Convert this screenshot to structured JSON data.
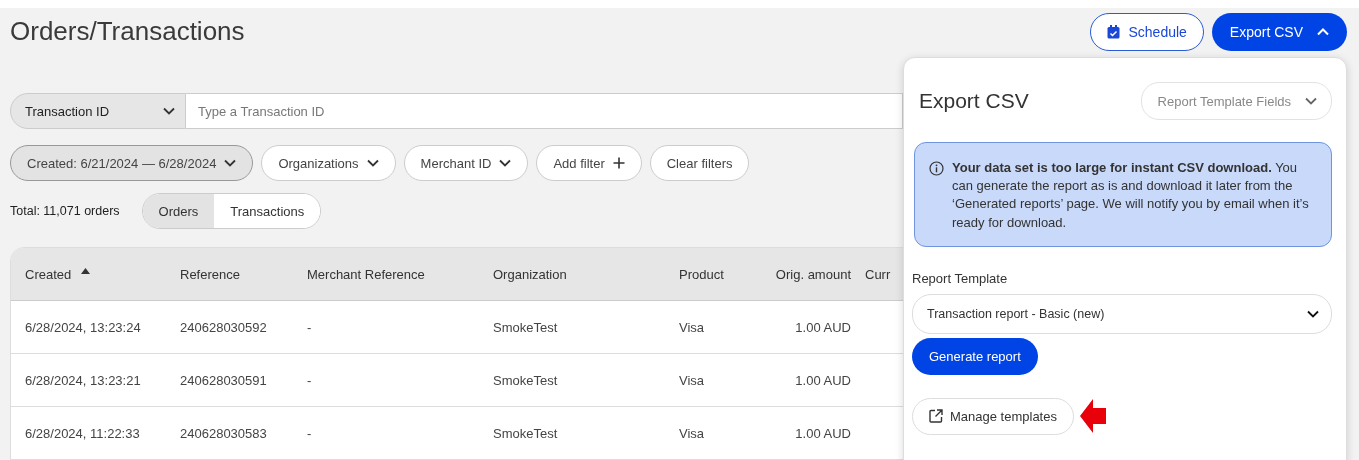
{
  "page": {
    "title": "Orders/Transactions"
  },
  "header_buttons": [
    {
      "kind": "schedule",
      "label": "Schedule"
    },
    {
      "kind": "export",
      "label": "Export CSV",
      "expanded": true
    }
  ],
  "search": {
    "type_select": "Transaction ID",
    "placeholder": "Type a Transaction ID"
  },
  "filters": [
    {
      "kind": "date",
      "label": "Created: 6/21/2024 — 6/28/2024",
      "active": true
    },
    {
      "kind": "dropdown",
      "label": "Organizations",
      "active": false
    },
    {
      "kind": "dropdown",
      "label": "Merchant ID",
      "active": false
    },
    {
      "kind": "add",
      "label": "Add filter",
      "active": false
    },
    {
      "kind": "clear",
      "label": "Clear filters",
      "active": false
    }
  ],
  "total": "Total: 11,071 orders",
  "view_tabs": [
    {
      "label": "Orders",
      "selected": true
    },
    {
      "label": "Transactions",
      "selected": false
    }
  ],
  "table": {
    "columns": [
      {
        "label": "Created",
        "sorted": true
      },
      {
        "label": "Reference",
        "sorted": false
      },
      {
        "label": "Merchant Reference",
        "sorted": false
      },
      {
        "label": "Organization",
        "sorted": false
      },
      {
        "label": "Product",
        "sorted": false
      },
      {
        "label": "Orig. amount",
        "sorted": false
      },
      {
        "label": "Curr",
        "sorted": false
      }
    ],
    "rows": [
      [
        "6/28/2024, 13:23:24",
        "240628030592",
        "-",
        "SmokeTest",
        "Visa",
        "1.00 AUD"
      ],
      [
        "6/28/2024, 13:23:21",
        "240628030591",
        "-",
        "SmokeTest",
        "Visa",
        "1.00 AUD"
      ],
      [
        "6/28/2024, 11:22:33",
        "240628030583",
        "-",
        "SmokeTest",
        "Visa",
        "1.00 AUD"
      ]
    ]
  },
  "export_panel": {
    "title": "Export CSV",
    "fields_select": "Report Template Fields",
    "notice": "**Your data set is too large for instant CSV download.** You can generate the report as is and download it later from the ‘Generated reports’ page. We will notify you by email when it’s ready for download.",
    "template_label": "Report Template",
    "template_value": "Transaction report - Basic (new)",
    "generate_button": "Generate report",
    "manage_button": "Manage templates"
  }
}
